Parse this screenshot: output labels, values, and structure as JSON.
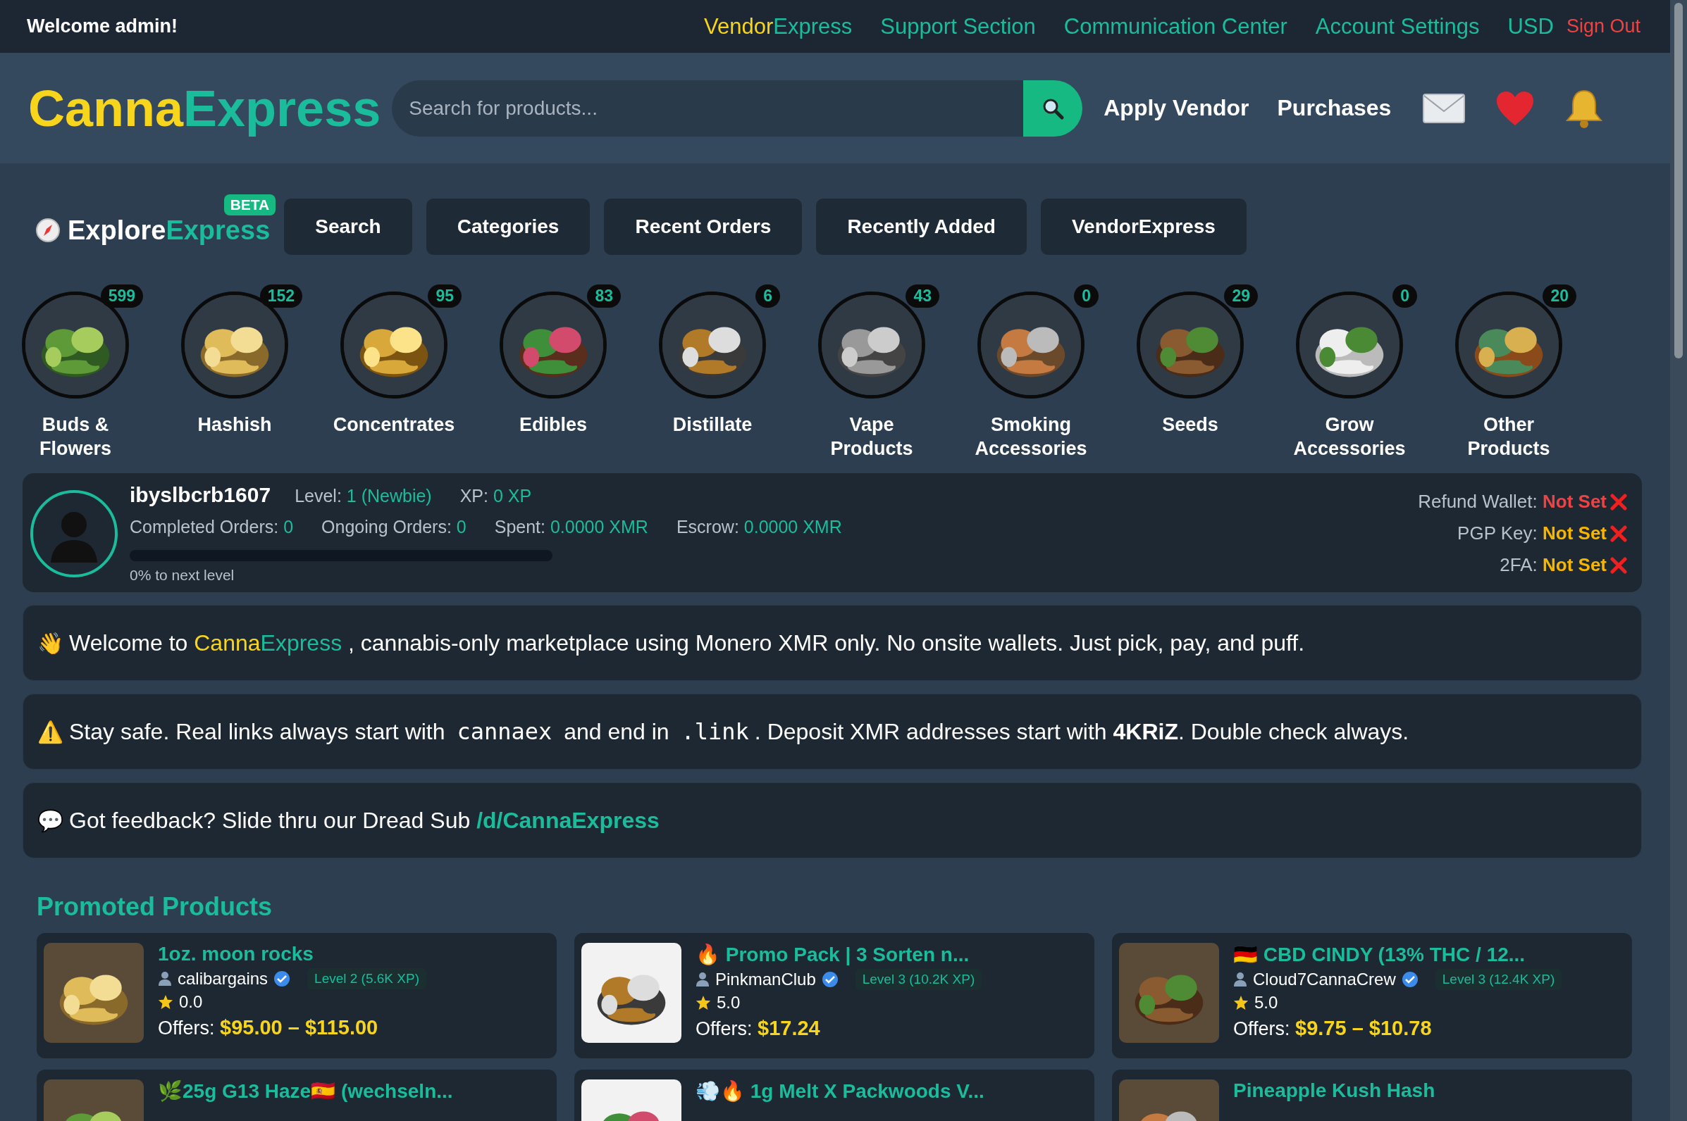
{
  "top_bar": {
    "welcome": "Welcome admin!",
    "links": [
      {
        "kind": "brand",
        "parts": [
          "Vendor",
          "Express"
        ]
      },
      {
        "kind": "link",
        "label": "Support Section"
      },
      {
        "kind": "link",
        "label": "Communication Center"
      },
      {
        "kind": "link",
        "label": "Account Settings"
      },
      {
        "kind": "link",
        "label": "USD"
      },
      {
        "kind": "signout",
        "label": "Sign Out"
      }
    ]
  },
  "header": {
    "logo": [
      "Canna",
      "Express"
    ],
    "search": {
      "placeholder": "Search for products..."
    },
    "links": [
      "Apply Vendor",
      "Purchases"
    ]
  },
  "explore": {
    "logo": [
      "Explore",
      "Express"
    ],
    "badge": "BETA",
    "buttons": [
      "Search",
      "Categories",
      "Recent Orders",
      "Recently Added",
      "VendorExpress"
    ]
  },
  "categories": [
    {
      "label": "Buds &\nFlowers",
      "count": "599"
    },
    {
      "label": "Hashish",
      "count": "152"
    },
    {
      "label": "Concentrates",
      "count": "95"
    },
    {
      "label": "Edibles",
      "count": "83"
    },
    {
      "label": "Distillate",
      "count": "6"
    },
    {
      "label": "Vape\nProducts",
      "count": "43"
    },
    {
      "label": "Smoking\nAccessories",
      "count": "0"
    },
    {
      "label": "Seeds",
      "count": "29"
    },
    {
      "label": "Grow\nAccessories",
      "count": "0"
    },
    {
      "label": "Other\nProducts",
      "count": "20"
    }
  ],
  "profile": {
    "username": "ibyslbcrb1607",
    "level_stats": [
      {
        "label": "Level:",
        "value": "1 (Newbie)"
      },
      {
        "label": "XP:",
        "value": "0 XP"
      }
    ],
    "order_stats": [
      {
        "label": "Completed Orders:",
        "value": "0"
      },
      {
        "label": "Ongoing Orders:",
        "value": "0"
      },
      {
        "label": "Spent:",
        "value": "0.0000 XMR"
      },
      {
        "label": "Escrow:",
        "value": "0.0000 XMR"
      }
    ],
    "progress": {
      "level": 0,
      "caption": "0% to next level"
    },
    "security": [
      {
        "label": "Refund Wallet:",
        "value": "Not Set",
        "color": "#ef4343",
        "set": false
      },
      {
        "label": "PGP Key:",
        "value": "Not Set",
        "color": "#f7b500",
        "set": false
      },
      {
        "label": "2FA:",
        "value": "Not Set",
        "color": "#f7b500",
        "set": false
      }
    ]
  },
  "banners": [
    {
      "icon": "👋",
      "segments": [
        {
          "kind": "text",
          "text": "Welcome to "
        },
        {
          "kind": "yellow",
          "text": "Canna"
        },
        {
          "kind": "green",
          "text": "Express"
        },
        {
          "kind": "text",
          "text": " , cannabis-only marketplace using Monero XMR only. No onsite wallets. Just pick, pay, and puff."
        }
      ]
    },
    {
      "icon": "⚠️",
      "segments": [
        {
          "kind": "text",
          "text": "Stay safe. Real links always start with "
        },
        {
          "kind": "code",
          "text": "cannaex"
        },
        {
          "kind": "text",
          "text": " and end in "
        },
        {
          "kind": "code",
          "text": ".link"
        },
        {
          "kind": "text",
          "text": ". Deposit XMR addresses start with "
        },
        {
          "kind": "bold",
          "text": "4KRiZ"
        },
        {
          "kind": "text",
          "text": ". Double check always."
        }
      ]
    },
    {
      "icon": "💬",
      "segments": [
        {
          "kind": "text",
          "text": "Got feedback? Slide thru our Dread Sub "
        },
        {
          "kind": "link",
          "text": "/d/CannaExpress"
        }
      ]
    }
  ],
  "promoted": {
    "title": "Promoted Products",
    "products": [
      {
        "title": "1oz. moon rocks",
        "vendor": "calibargains",
        "level": "Level 2 (5.6K XP)",
        "rating": "0.0",
        "offers_label": "Offers:",
        "price": "$95.00 – $115.00"
      },
      {
        "title": "🔥 Promo Pack | 3 Sorten n...",
        "vendor": "PinkmanClub",
        "level": "Level 3 (10.2K XP)",
        "rating": "5.0",
        "offers_label": "Offers:",
        "price": "$17.24"
      },
      {
        "title": "🇩🇪 CBD CINDY (13% THC / 12...",
        "vendor": "Cloud7CannaCrew",
        "level": "Level 3 (12.4K XP)",
        "rating": "5.0",
        "offers_label": "Offers:",
        "price": "$9.75 – $10.78"
      },
      {
        "title": "🌿25g G13 Haze🇪🇸 (wechseln..."
      },
      {
        "title": "💨🔥 1g Melt X Packwoods V..."
      },
      {
        "title": "Pineapple Kush Hash"
      }
    ]
  }
}
